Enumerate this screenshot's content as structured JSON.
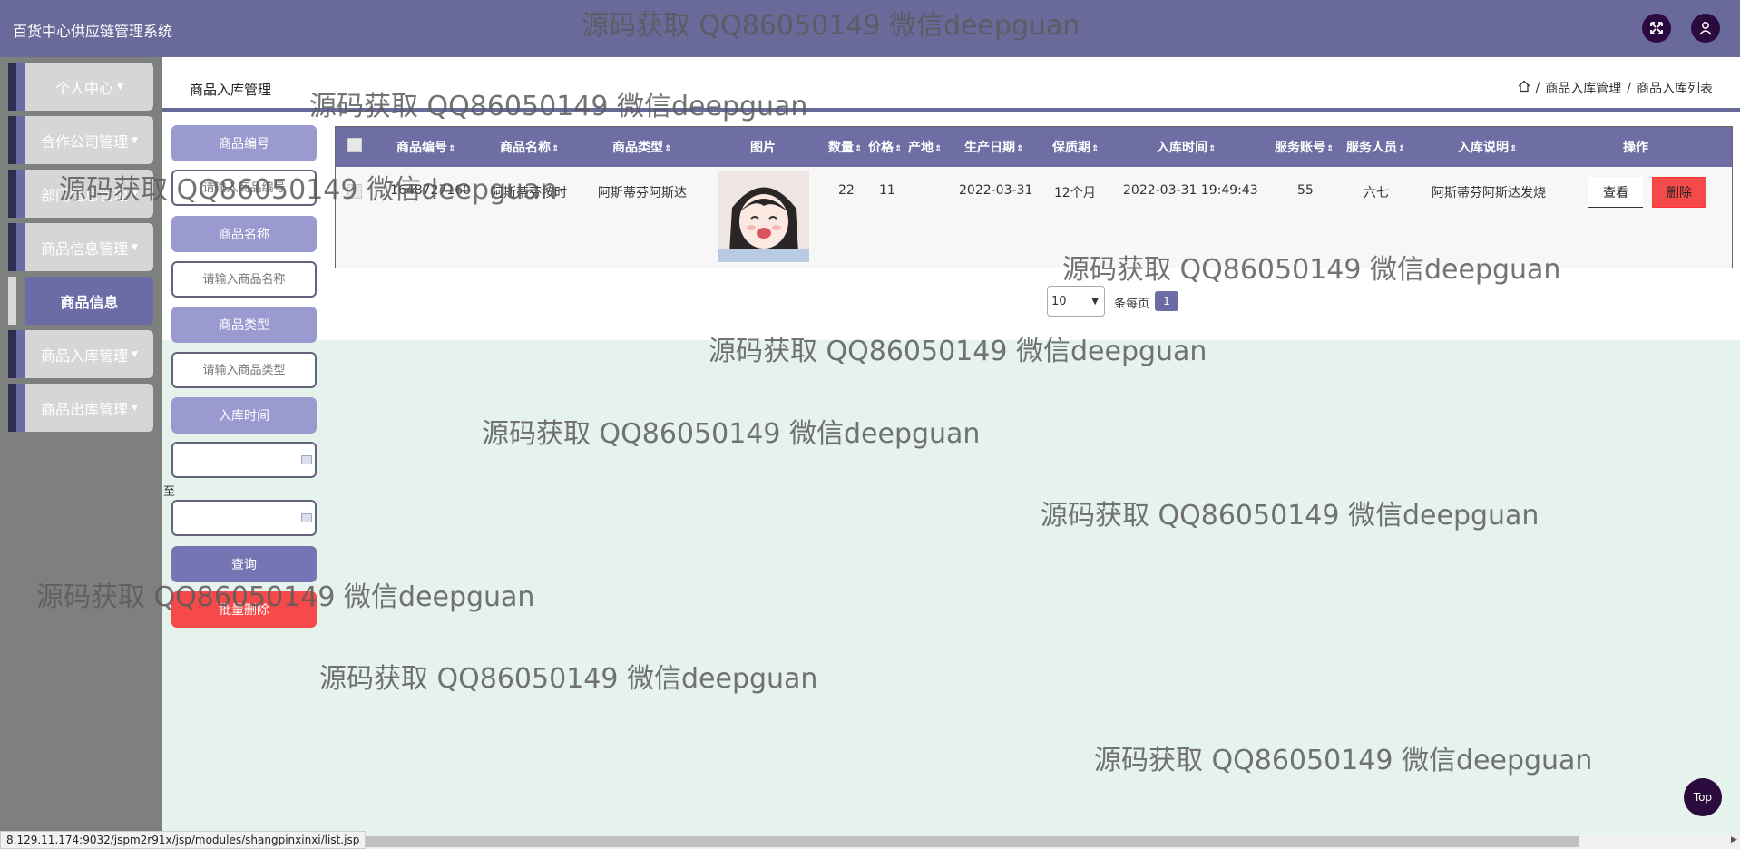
{
  "app": {
    "title": "百货中心供应链管理系统"
  },
  "sidebar": {
    "items": [
      {
        "label": "个人中心"
      },
      {
        "label": "合作公司管理"
      },
      {
        "label": "部门信息管理"
      },
      {
        "label": "商品信息管理"
      },
      {
        "label": "商品信息"
      },
      {
        "label": "商品入库管理"
      },
      {
        "label": "商品出库管理"
      }
    ]
  },
  "header": {
    "title": "商品入库管理",
    "breadcrumb": [
      "商品入库管理",
      "商品入库列表"
    ]
  },
  "search": {
    "fields": [
      {
        "label": "商品编号",
        "placeholder": "请输入商品编号"
      },
      {
        "label": "商品名称",
        "placeholder": "请输入商品名称"
      },
      {
        "label": "商品类型",
        "placeholder": "请输入商品类型"
      },
      {
        "label": "入库时间"
      }
    ],
    "to_label": "至",
    "query_button": "查询",
    "batch_delete_button": "批量删除"
  },
  "table": {
    "columns": [
      "商品编号",
      "商品名称",
      "商品类型",
      "图片",
      "数量",
      "价格",
      "产地",
      "生产日期",
      "保质期",
      "入库时间",
      "服务账号",
      "服务人员",
      "入库说明",
      "操作"
    ],
    "rows": [
      {
        "code": "1648727160",
        "name": "阿斯蒂芬按时",
        "type": "阿斯蒂芬阿斯达",
        "qty": "22",
        "price": "11",
        "origin": "",
        "prod_date": "2022-03-31",
        "shelf_life": "12个月",
        "in_time": "2022-03-31 19:49:43",
        "account": "55",
        "staff": "六七",
        "note": "阿斯蒂芬阿斯达发烧",
        "view_label": "查看",
        "delete_label": "删除"
      }
    ]
  },
  "pagination": {
    "page_size": "10",
    "per_page_label": "条每页",
    "current_page": "1"
  },
  "to_top": "Top",
  "status_url": "8.129.11.174:9032/jspm2r91x/jsp/modules/shangpinxinxi/list.jsp",
  "watermark": "源码获取 QQ86050149 微信deepguan"
}
